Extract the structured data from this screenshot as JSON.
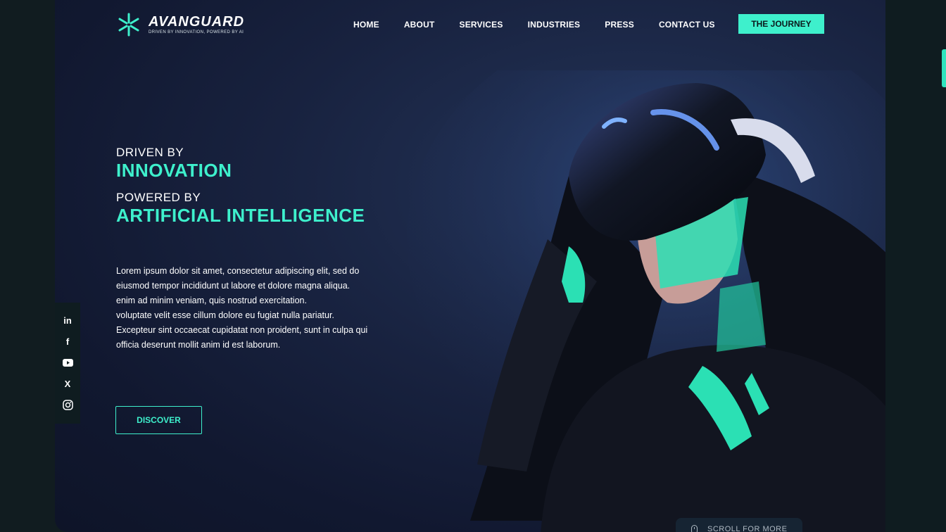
{
  "brand": {
    "name": "AVANGUARD",
    "tagline": "DRIVEN BY INNOVATION, POWERED BY AI",
    "accent": "#3ef0cc"
  },
  "nav": {
    "items": [
      {
        "label": "HOME"
      },
      {
        "label": "ABOUT"
      },
      {
        "label": "SERVICES"
      },
      {
        "label": "INDUSTRIES"
      },
      {
        "label": "PRESS"
      },
      {
        "label": "CONTACT US"
      }
    ],
    "cta": "THE JOURNEY"
  },
  "hero": {
    "line1_small": "DRIVEN BY",
    "line1_big": "INNOVATION",
    "line2_small": "POWERED BY",
    "line2_big": "ARTIFICIAL INTELLIGENCE",
    "body_lines": [
      "Lorem ipsum dolor sit amet, consectetur adipiscing elit, sed do",
      "eiusmod tempor incididunt ut labore et dolore magna aliqua.",
      "enim ad minim veniam, quis nostrud exercitation.",
      "voluptate velit esse cillum dolore eu fugiat nulla pariatur.",
      "Excepteur sint occaecat cupidatat non proident, sunt in culpa qui",
      "officia deserunt mollit anim id est laborum."
    ],
    "button": "DISCOVER"
  },
  "social": {
    "icons": [
      "linkedin-icon",
      "facebook-icon",
      "youtube-icon",
      "x-icon",
      "instagram-icon"
    ],
    "linkedin_glyph": "in",
    "facebook_glyph": "f",
    "x_glyph": "X"
  },
  "scroll": {
    "label": "SCROLL FOR MORE"
  }
}
